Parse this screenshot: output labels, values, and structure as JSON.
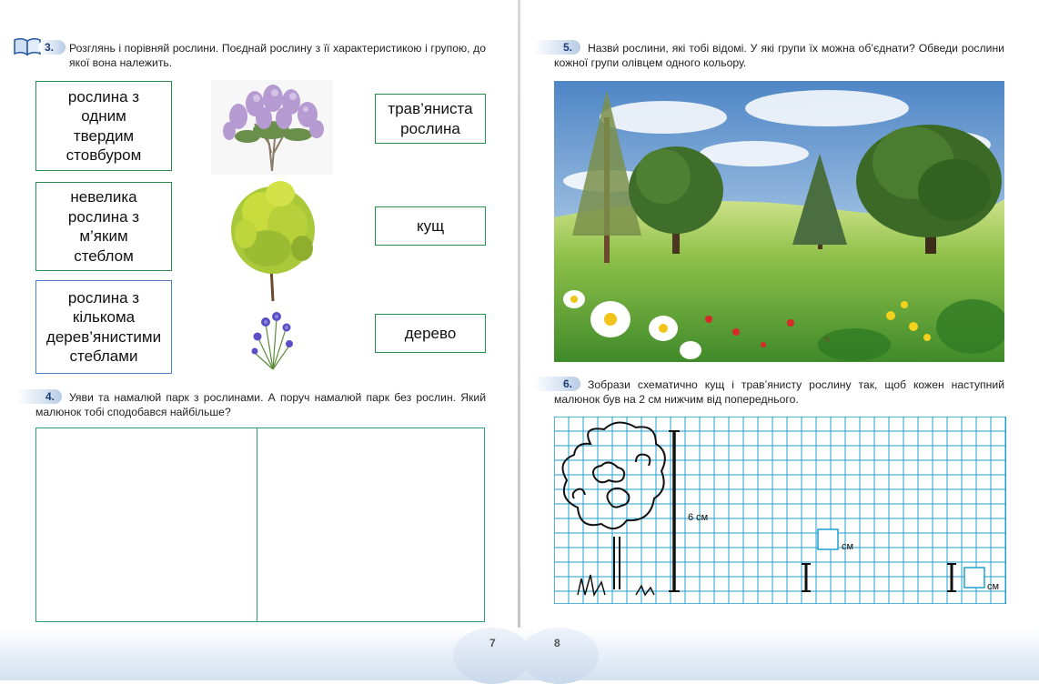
{
  "left_page": {
    "task3": {
      "number": "3.",
      "text": "Розглянь і порівняй рослини. Поєднай рослину з її характеристикою і групою, до якої вона належить.",
      "characteristics": [
        "рослина з одним твердим стовбуром",
        "невелика рослина з м’яким стеблом",
        "рослина з кількома дерев’янистими стеблами"
      ],
      "groups": [
        "трав’яниста рослина",
        "кущ",
        "дерево"
      ]
    },
    "task4": {
      "number": "4.",
      "text": "Уяви та намалюй парк з рослинами. А поруч намалюй парк без рослин. Який малюнок тобі сподобався найбільше?"
    },
    "page_number": "7"
  },
  "right_page": {
    "task5": {
      "number": "5.",
      "text": "Назви́ рослини, які тобі відомі. У які групи їх можна об’єднати? Обведи рослини кожної групи олівцем одного кольору."
    },
    "task6": {
      "number": "6.",
      "text": "Зобрази схематично кущ і трав’янисту рослину так, щоб кожен наступний малюнок був на 2 см нижчим від попереднього.",
      "label_first": "6 см",
      "label_unit_1": "см",
      "label_unit_2": "см"
    },
    "page_number": "8"
  },
  "colors": {
    "box_green": "#2a8f4d",
    "box_blue": "#4a7fc1",
    "grid_blue": "#1f9fd0",
    "task_number": "#1d3b78"
  }
}
